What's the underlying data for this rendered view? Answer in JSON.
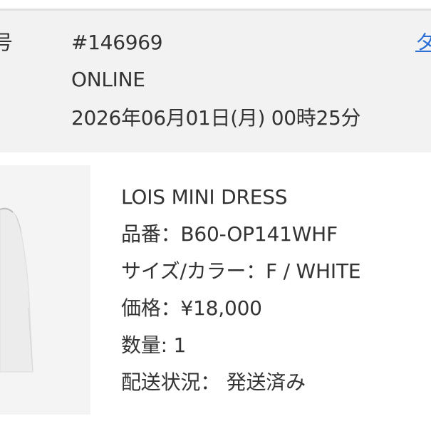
{
  "order": {
    "label_fragment": "号",
    "number": "#146969",
    "channel": "ONLINE",
    "datetime": "2026年06月01日(月) 00時25分",
    "link_fragment": "タ"
  },
  "product": {
    "name": "LOIS MINI DRESS",
    "sku_label": "品番：",
    "sku_value": "B60-OP141WHF",
    "size_color_label": "サイズ/カラー：",
    "size_color_value": "F / WHITE",
    "price_label": "価格：",
    "price_value": "¥18,000",
    "quantity_label": "数量: ",
    "quantity_value": "1",
    "shipping_label": "配送状況：",
    "shipping_value": "発送済み"
  },
  "colors": {
    "header_bg": "#f2f2f2",
    "link": "#2a6fd6",
    "text": "#333333"
  }
}
